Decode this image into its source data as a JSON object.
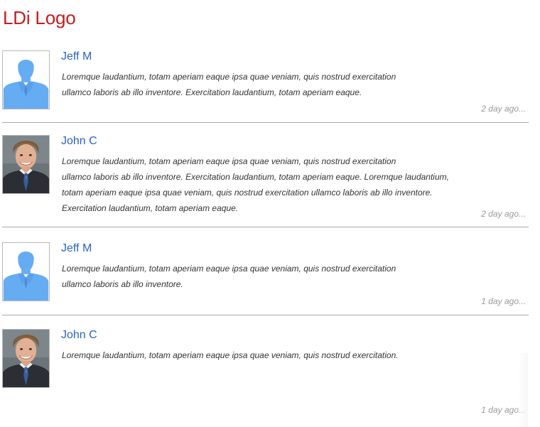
{
  "header": {
    "logo_text": "LDi Logo"
  },
  "colors": {
    "logo": "#c41e1e",
    "author_link": "#2a63c6",
    "placeholder_avatar": "#66acf2",
    "timestamp": "#9a9a9a",
    "divider": "#a8a8a8"
  },
  "comments": [
    {
      "author": "Jeff M",
      "avatar": "default-user-silhouette-icon",
      "lines": [
        "Loremque laudantium, totam aperiam eaque ipsa quae veniam, quis nostrud exercitation",
        "ullamco laboris ab illo inventore. Exercitation laudantium, totam aperiam eaque."
      ],
      "time": "2 day ago..."
    },
    {
      "author": "John C",
      "avatar": "user-photo",
      "lines": [
        "Loremque laudantium, totam aperiam eaque ipsa quae veniam, quis nostrud exercitation",
        "ullamco laboris ab illo inventore. Exercitation laudantium, totam aperiam eaque. Loremque laudantium,",
        "totam aperiam eaque ipsa quae veniam, quis nostrud exercitation ullamco laboris ab illo inventore.",
        "Exercitation laudantium, totam aperiam eaque."
      ],
      "time": "2 day ago..."
    },
    {
      "author": "Jeff M",
      "avatar": "default-user-silhouette-icon",
      "lines": [
        "Loremque laudantium, totam aperiam eaque ipsa quae veniam, quis nostrud exercitation",
        "ullamco laboris ab illo inventore."
      ],
      "time": "1 day ago..."
    },
    {
      "author": "John C",
      "avatar": "user-photo",
      "lines": [
        "Loremque laudantium, totam aperiam eaque ipsa quae veniam, quis nostrud exercitation."
      ],
      "time": "1 day ago..."
    }
  ]
}
